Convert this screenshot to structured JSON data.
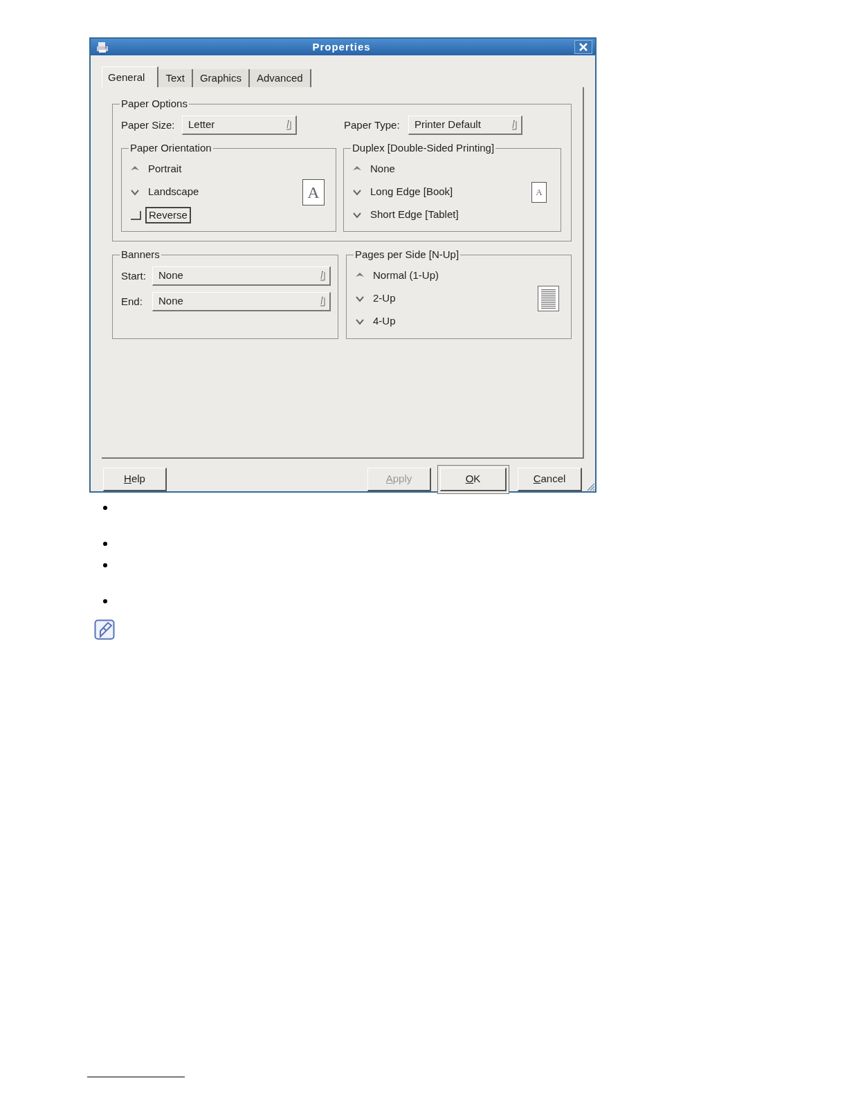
{
  "window": {
    "title": "Properties"
  },
  "tabs": [
    {
      "label": "General",
      "selected": true
    },
    {
      "label": "Text",
      "selected": false
    },
    {
      "label": "Graphics",
      "selected": false
    },
    {
      "label": "Advanced",
      "selected": false
    }
  ],
  "paper_options": {
    "title": "Paper Options",
    "paper_size": {
      "label": "Paper Size:",
      "value": "Letter"
    },
    "paper_type": {
      "label": "Paper Type:",
      "value": "Printer Default"
    },
    "orientation": {
      "title": "Paper Orientation",
      "preview": "A",
      "options": [
        {
          "label": "Portrait",
          "selected": true
        },
        {
          "label": "Landscape",
          "selected": false
        }
      ],
      "reverse": {
        "label": "Reverse",
        "checked": false,
        "focused": true
      }
    },
    "duplex": {
      "title": "Duplex [Double-Sided Printing]",
      "preview": "A",
      "options": [
        {
          "label": "None",
          "selected": true
        },
        {
          "label": "Long Edge [Book]",
          "selected": false
        },
        {
          "label": "Short Edge [Tablet]",
          "selected": false
        }
      ]
    }
  },
  "banners": {
    "title": "Banners",
    "fields": [
      {
        "label": "Start:",
        "value": "None"
      },
      {
        "label": "End:",
        "value": "None"
      }
    ]
  },
  "pages_per_side": {
    "title": "Pages per Side [N-Up]",
    "options": [
      {
        "label": "Normal (1-Up)",
        "selected": true
      },
      {
        "label": "2-Up",
        "selected": false
      },
      {
        "label": "4-Up",
        "selected": false
      }
    ]
  },
  "buttons": [
    {
      "label": "Help",
      "disabled": false,
      "default": false
    },
    {
      "label": "Apply",
      "disabled": true,
      "default": false
    },
    {
      "label": "OK",
      "disabled": false,
      "default": true
    },
    {
      "label": "Cancel",
      "disabled": false,
      "default": false
    }
  ]
}
